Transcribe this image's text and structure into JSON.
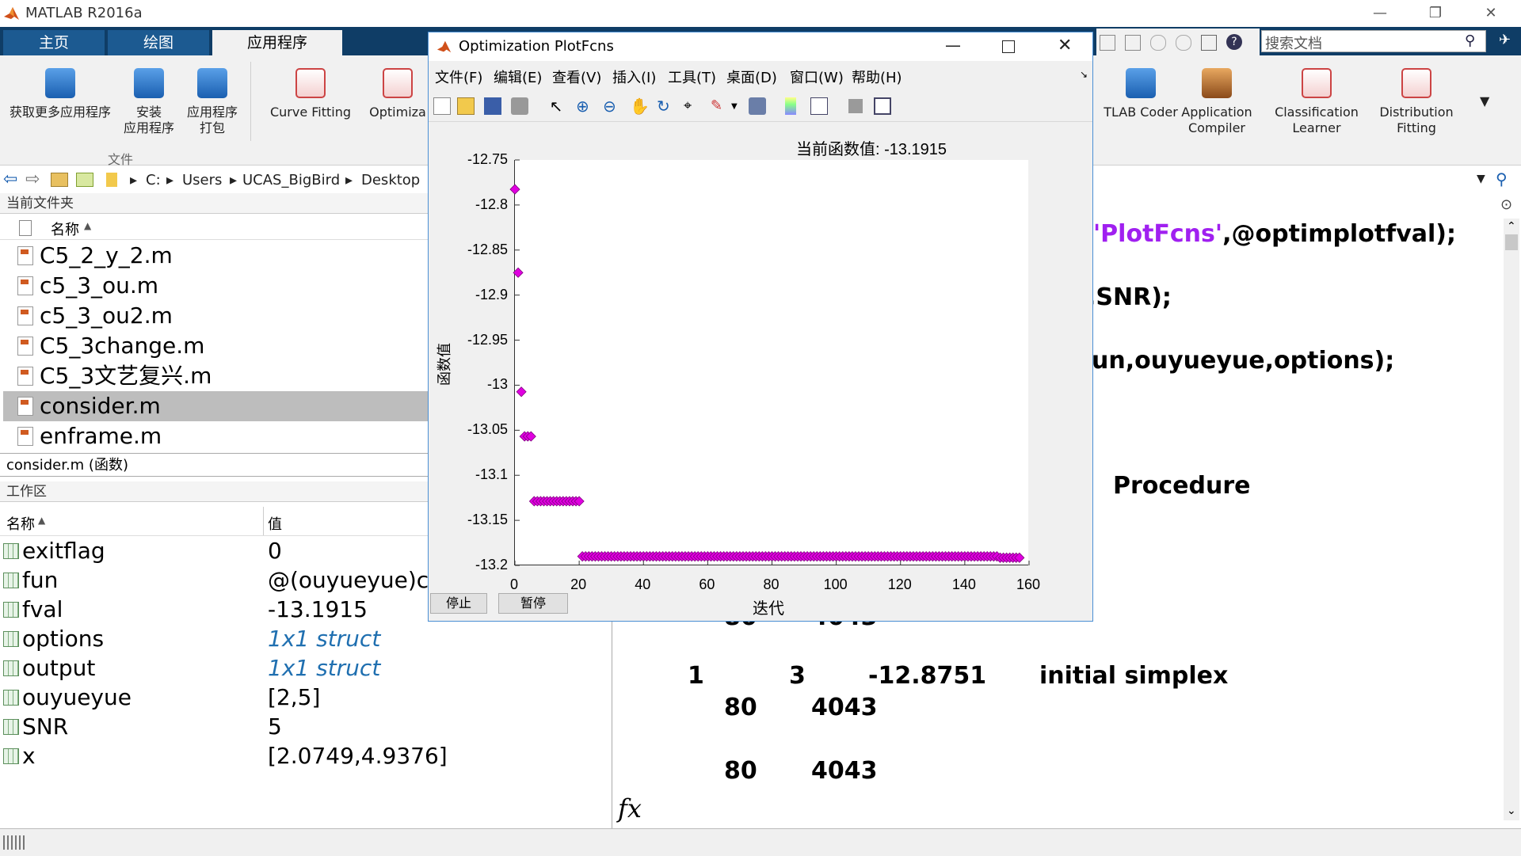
{
  "window": {
    "title": "MATLAB R2016a",
    "minimize": "—",
    "restore": "❐",
    "close": "✕"
  },
  "ribbon": {
    "tabs": [
      "主页",
      "绘图",
      "应用程序"
    ],
    "buttons_left": [
      {
        "label1": "获取更多应用程序",
        "label2": ""
      },
      {
        "label1": "安装",
        "label2": "应用程序"
      },
      {
        "label1": "应用程序",
        "label2": "打包"
      }
    ],
    "group_label": "文件",
    "apps_left": [
      {
        "label": "Curve Fitting"
      },
      {
        "label": "Optimiza"
      }
    ],
    "apps_right": [
      {
        "label1": "TLAB Coder",
        "label2": ""
      },
      {
        "label1": "Application",
        "label2": "Compiler"
      },
      {
        "label1": "Classification",
        "label2": "Learner"
      },
      {
        "label1": "Distribution",
        "label2": "Fitting"
      }
    ],
    "search_placeholder": "搜索文档"
  },
  "address": {
    "crumbs": [
      "C:",
      "Users",
      "UCAS_BigBird",
      "Desktop"
    ]
  },
  "current_folder": {
    "title": "当前文件夹",
    "col_name": "名称",
    "files": [
      "C5_2_y_2.m",
      "c5_3_ou.m",
      "c5_3_ou2.m",
      "C5_3change.m",
      "C5_3文艺复兴.m",
      "consider.m",
      "enframe.m"
    ],
    "selected_index": 5,
    "details": "consider.m  (函数)"
  },
  "workspace": {
    "title": "工作区",
    "col_name": "名称",
    "col_value": "值",
    "vars": [
      {
        "name": "exitflag",
        "value": "0",
        "italic": false
      },
      {
        "name": "fun",
        "value": "@(ouyueyue)cc",
        "italic": false
      },
      {
        "name": "fval",
        "value": "-13.1915",
        "italic": false
      },
      {
        "name": "options",
        "value": "1x1 struct",
        "italic": true
      },
      {
        "name": "output",
        "value": "1x1 struct",
        "italic": true
      },
      {
        "name": "ouyueyue",
        "value": "[2,5]",
        "italic": false
      },
      {
        "name": "SNR",
        "value": "5",
        "italic": false
      },
      {
        "name": "x",
        "value": "[2.0749,4.9376]",
        "italic": false
      }
    ]
  },
  "command": {
    "line1a": "'PlotFcns'",
    "line1b": ",@optimplotfval);",
    "line2": ",SNR);",
    "line3": "un,ouyueyue,options);",
    "procedure": "Procedure",
    "row_a": [
      "80",
      "4043"
    ],
    "row_b": [
      "1",
      "3",
      "-12.8751",
      "initial simplex"
    ],
    "row_c": [
      "80",
      "4043"
    ],
    "row_d": [
      "80",
      "4043"
    ],
    "fx": "fx"
  },
  "figure": {
    "title": "Optimization PlotFcns",
    "menus": [
      "文件(F)",
      "编辑(E)",
      "查看(V)",
      "插入(I)",
      "工具(T)",
      "桌面(D)",
      "窗口(W)",
      "帮助(H)"
    ],
    "stop_label": "停止",
    "pause_label": "暂停"
  },
  "chart_data": {
    "type": "scatter",
    "title": "当前函数值: -13.1915",
    "xlabel": "迭代",
    "ylabel": "函数值",
    "xlim": [
      0,
      160
    ],
    "ylim": [
      -13.2,
      -12.75
    ],
    "xticks": [
      0,
      20,
      40,
      60,
      80,
      100,
      120,
      140,
      160
    ],
    "yticks": [
      -12.75,
      -12.8,
      -12.85,
      -12.9,
      -12.95,
      -13,
      -13.05,
      -13.1,
      -13.15,
      -13.2
    ],
    "marker_color": "#e000e0",
    "series": [
      {
        "x": [
          0,
          1,
          2,
          3,
          4,
          5,
          6,
          7,
          8,
          9,
          10,
          11,
          12,
          13,
          14,
          15,
          16,
          17,
          18,
          19,
          20
        ],
        "y": [
          -12.7826,
          -12.8751,
          -13.0073,
          -13.0568,
          -13.0568,
          -13.0568,
          -13.1288,
          -13.1288,
          -13.1288,
          -13.1288,
          -13.1288,
          -13.1288,
          -13.1288,
          -13.1288,
          -13.1288,
          -13.1288,
          -13.1288,
          -13.1288,
          -13.1288,
          -13.1288,
          -13.1288
        ]
      },
      {
        "x_start": 21,
        "x_end": 150,
        "y": -13.19
      },
      {
        "x": [
          151,
          152,
          153,
          154,
          155,
          156,
          157
        ],
        "y": [
          -13.1915,
          -13.1915,
          -13.1915,
          -13.1915,
          -13.1915,
          -13.1915,
          -13.1915
        ]
      }
    ]
  }
}
